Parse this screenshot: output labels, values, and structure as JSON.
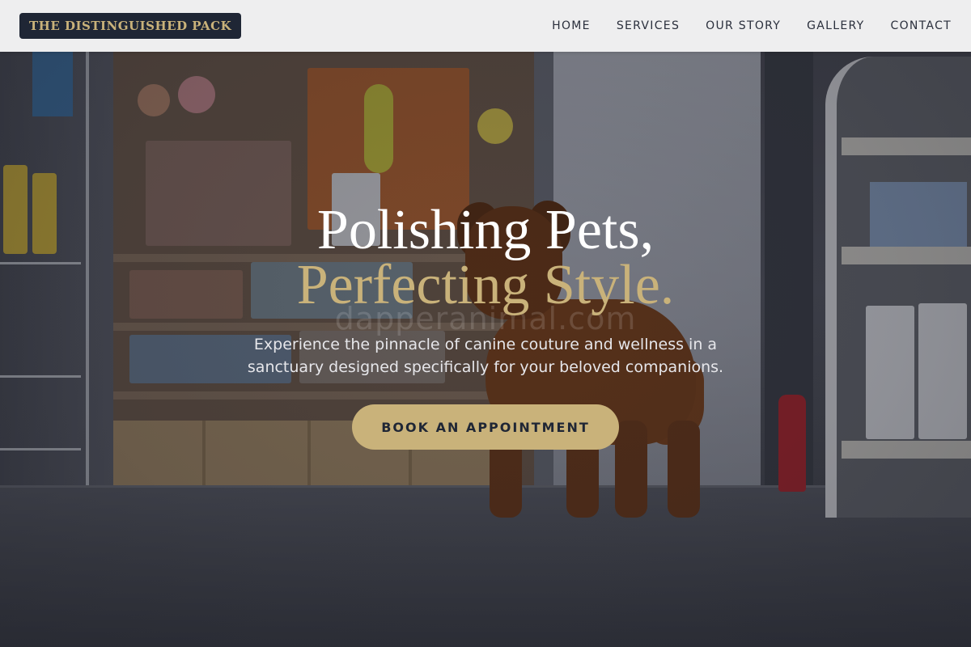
{
  "brand": {
    "name": "THE DISTINGUISHED PACK"
  },
  "nav": {
    "items": [
      {
        "label": "HOME"
      },
      {
        "label": "SERVICES"
      },
      {
        "label": "OUR STORY"
      },
      {
        "label": "GALLERY"
      },
      {
        "label": "CONTACT"
      }
    ]
  },
  "hero": {
    "headline_line1": "Polishing Pets,",
    "headline_line2": "Perfecting Style.",
    "subtitle": "Experience the pinnacle of canine couture and wellness in a sanctuary designed specifically for your beloved companions.",
    "cta_label": "BOOK AN APPOINTMENT",
    "watermark": "dapperanimal.com"
  },
  "colors": {
    "accent_gold": "#c9b27a",
    "navy": "#1f2635",
    "nav_background": "#f6f6f7"
  }
}
